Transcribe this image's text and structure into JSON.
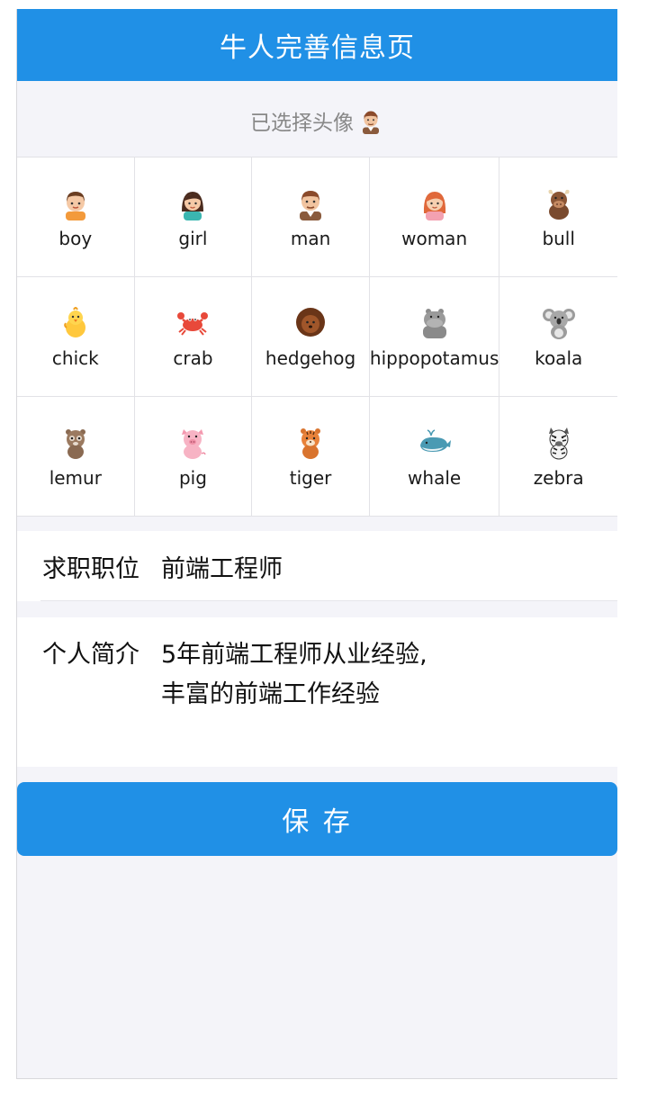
{
  "navbar": {
    "title": "牛人完善信息页"
  },
  "avatar_picker": {
    "selected_label": "已选择头像",
    "selected_icon": "man-avatar-icon",
    "items": [
      {
        "label": "boy",
        "icon": "boy-avatar-icon"
      },
      {
        "label": "girl",
        "icon": "girl-avatar-icon"
      },
      {
        "label": "man",
        "icon": "man-avatar-icon"
      },
      {
        "label": "woman",
        "icon": "woman-avatar-icon"
      },
      {
        "label": "bull",
        "icon": "bull-avatar-icon"
      },
      {
        "label": "chick",
        "icon": "chick-avatar-icon"
      },
      {
        "label": "crab",
        "icon": "crab-avatar-icon"
      },
      {
        "label": "hedgehog",
        "icon": "hedgehog-avatar-icon"
      },
      {
        "label": "hippopotamus",
        "icon": "hippopotamus-avatar-icon"
      },
      {
        "label": "koala",
        "icon": "koala-avatar-icon"
      },
      {
        "label": "lemur",
        "icon": "lemur-avatar-icon"
      },
      {
        "label": "pig",
        "icon": "pig-avatar-icon"
      },
      {
        "label": "tiger",
        "icon": "tiger-avatar-icon"
      },
      {
        "label": "whale",
        "icon": "whale-avatar-icon"
      },
      {
        "label": "zebra",
        "icon": "zebra-avatar-icon"
      }
    ]
  },
  "form": {
    "position_label": "求职职位",
    "position_value": "前端工程师",
    "intro_label": "个人简介",
    "intro_value": "5年前端工程师从业经验,\n丰富的前端工作经验"
  },
  "save_button": {
    "label": "保 存"
  },
  "colors": {
    "primary": "#2090e6",
    "background": "#f4f4f9"
  }
}
